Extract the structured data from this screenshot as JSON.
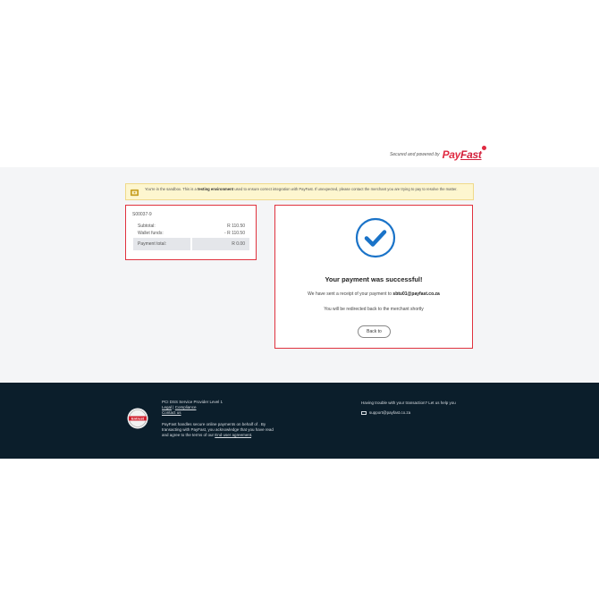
{
  "header": {
    "powered_by": "Secured and powered by",
    "logo_pay": "Pay",
    "logo_fast": "Fast"
  },
  "banner": {
    "text_pre": "You're in the sandbox. This is a ",
    "text_bold": "testing environment",
    "text_post": " used to ensure correct integration with PayFast. If unexpected, please contact the merchant you are trying to pay to resolve the matter."
  },
  "summary": {
    "reference": "S00037-9",
    "subtotal_label": "Subtotal:",
    "subtotal_value": "R 110.50",
    "wallet_label": "Wallet funds:",
    "wallet_value": "- R 110.50",
    "total_label": "Payment total:",
    "total_value": "R 0.00"
  },
  "result": {
    "title": "Your payment was successful!",
    "receipt_pre": "We have sent a receipt of your payment to ",
    "receipt_email": "sbtu01@payfast.co.za",
    "redirect": "You will be redirected back to the merchant shortly",
    "back_label": "Back to"
  },
  "footer": {
    "badge_text": "Entrust",
    "pci": "PCI DSS Service Provider Level 1",
    "legal": "Legal",
    "sep": "|",
    "compliance": "Compliance",
    "contact": "Contact us",
    "para_line1": "PayFast handles secure online payments on behalf of . By",
    "para_line2": "transacting with PayFast, you acknowledge that you have read",
    "para_line3_pre": "and agree to the terms of our ",
    "para_link": "End user agreement",
    "para_end": ".",
    "help": "Having trouble with your transaction? Let us help you",
    "email": "support@payfast.co.za"
  },
  "colors": {
    "accent_red": "#e0323e",
    "check_blue": "#1a73c8",
    "footer_bg": "#0b1e2b",
    "banner_bg": "#fdf6cf"
  }
}
